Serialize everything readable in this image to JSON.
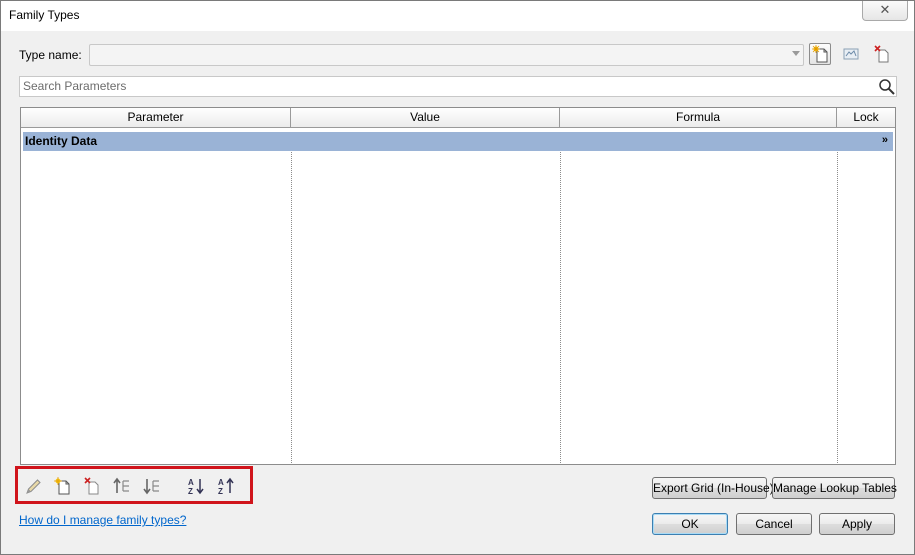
{
  "window": {
    "title": "Family Types",
    "close_glyph": "✕"
  },
  "type_row": {
    "label": "Type name:",
    "value": "",
    "icons": [
      "new-type-icon",
      "rename-type-icon",
      "delete-type-icon"
    ]
  },
  "search": {
    "placeholder": "Search Parameters",
    "icon": "magnifier-icon"
  },
  "grid": {
    "columns": [
      "Parameter",
      "Value",
      "Formula",
      "Lock"
    ],
    "groups": [
      {
        "label": "Identity Data",
        "expander": "»"
      }
    ]
  },
  "toolbar": {
    "icons": [
      "edit-parameter-icon",
      "new-parameter-icon",
      "delete-parameter-icon",
      "move-up-icon",
      "move-down-icon",
      "sort-ascending-icon",
      "sort-descending-icon"
    ]
  },
  "buttons": {
    "export_grid": "Export Grid (In-House)",
    "manage_lookup": "Manage Lookup Tables",
    "ok": "OK",
    "cancel": "Cancel",
    "apply": "Apply"
  },
  "help_link": "How do I manage family types?",
  "colors": {
    "highlight_border": "#d0141b",
    "group_row": "#9ab3d6",
    "link": "#0066cc"
  }
}
